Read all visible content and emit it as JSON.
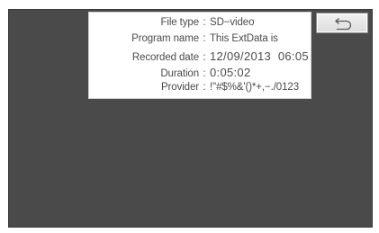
{
  "info": {
    "file_type": {
      "label": "File type",
      "separator": ":",
      "value": "SD−video"
    },
    "program_name": {
      "label": "Program name",
      "separator": ":",
      "value": "This ExtData is"
    },
    "recorded_date": {
      "label": "Recorded date",
      "separator": ":",
      "value": "12/09/2013  06:05"
    },
    "duration": {
      "label": "Duration",
      "separator": ":",
      "value": "0:05:02"
    },
    "provider": {
      "label": "Provider",
      "separator": ":",
      "value": "!\"#$%&'()*+,−./0123"
    }
  },
  "back_button": {
    "icon": "return-arrow-icon"
  },
  "colors": {
    "screen_background": "#4a4a4a",
    "panel_background": "#ffffff",
    "text": "#4b4b4b"
  }
}
